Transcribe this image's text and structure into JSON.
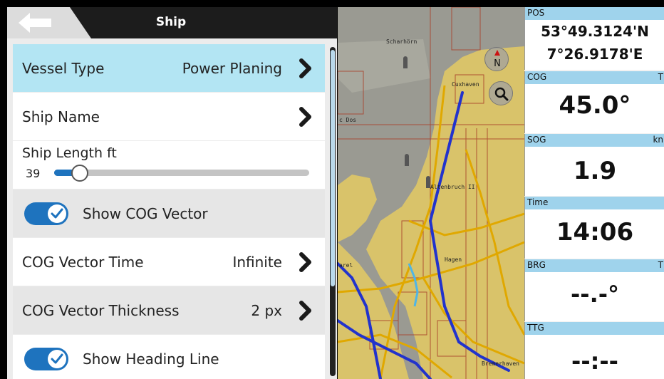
{
  "header": {
    "title": "Ship"
  },
  "settings": {
    "vessel_type": {
      "label": "Vessel Type",
      "value": "Power Planing"
    },
    "ship_name": {
      "label": "Ship Name"
    },
    "ship_length": {
      "label": "Ship Length ft",
      "value": "39",
      "slider_fraction": 0.1
    },
    "show_cog_vector": {
      "label": "Show COG Vector",
      "enabled": true
    },
    "cog_vector_time": {
      "label": "COG Vector Time",
      "value": "Infinite"
    },
    "cog_vector_thickness": {
      "label": "COG Vector Thickness",
      "value": "2 px"
    },
    "show_heading_line": {
      "label": "Show Heading Line",
      "enabled": true
    }
  },
  "map": {
    "labels": [
      "Scharhörn",
      "Cuxhaven",
      "c Dos",
      "Altenbruch II",
      "Hagen",
      "arel",
      "Bremerhaven"
    ],
    "compass_label": "N"
  },
  "data_panel": [
    {
      "name": "POS",
      "unit": "",
      "lines": [
        "53°49.3124'N",
        "7°26.9178'E"
      ]
    },
    {
      "name": "COG",
      "unit": "T",
      "lines": [
        "45.0°"
      ]
    },
    {
      "name": "SOG",
      "unit": "kn",
      "lines": [
        "1.9"
      ]
    },
    {
      "name": "Time",
      "unit": "",
      "lines": [
        "14:06"
      ]
    },
    {
      "name": "BRG",
      "unit": "T",
      "lines": [
        "--.-°"
      ]
    },
    {
      "name": "TTG",
      "unit": "",
      "lines": [
        "--:--"
      ]
    }
  ],
  "colors": {
    "selected_row": "#b3e5f3",
    "accent": "#1e73be",
    "data_header": "#9fd3ec",
    "land": "#d9c36a",
    "water": "#9a9a92",
    "route": "#2233cc"
  }
}
